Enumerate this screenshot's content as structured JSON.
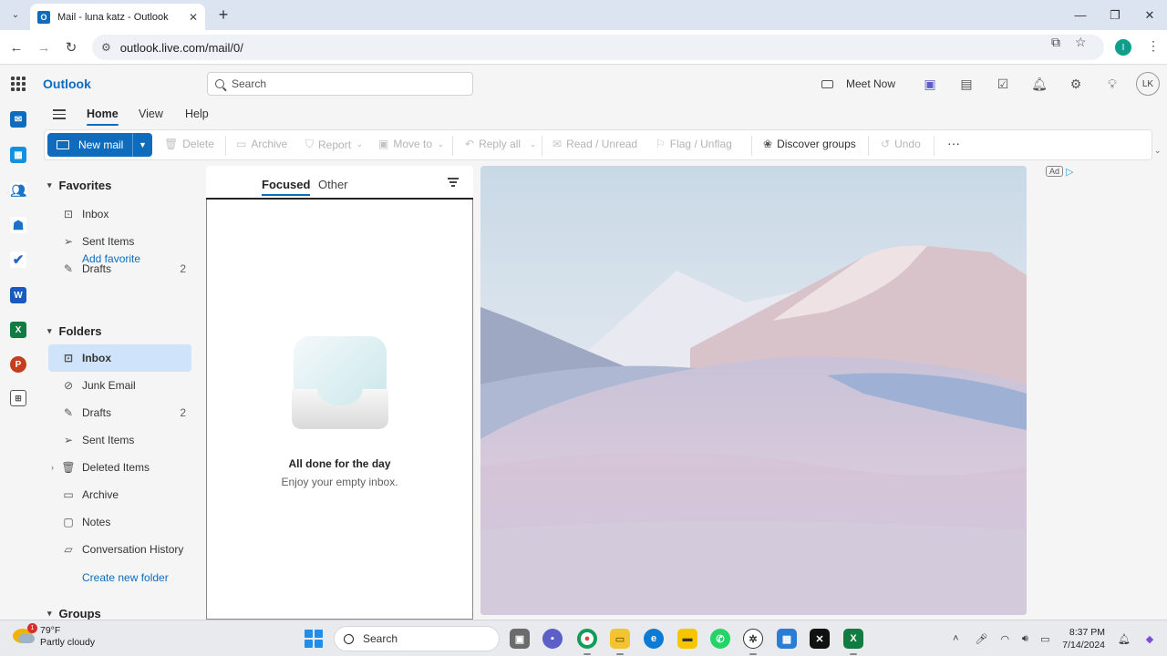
{
  "browser": {
    "tab_title": "Mail - luna katz - Outlook",
    "url": "outlook.live.com/mail/0/",
    "profile_initial": "I"
  },
  "app": {
    "brand": "Outlook",
    "search_placeholder": "Search",
    "meet_now": "Meet Now",
    "avatar_initials": "LK",
    "accent_color": "#0f6cbd"
  },
  "menu_tabs": [
    "Home",
    "View",
    "Help"
  ],
  "ribbon": {
    "new_mail": "New mail",
    "delete": "Delete",
    "archive": "Archive",
    "report": "Report",
    "move_to": "Move to",
    "reply_all": "Reply all",
    "read_unread": "Read / Unread",
    "flag_unflag": "Flag / Unflag",
    "discover_groups": "Discover groups",
    "undo": "Undo",
    "more": "···"
  },
  "favorites": {
    "header": "Favorites",
    "items": [
      {
        "label": "Inbox",
        "count": "",
        "icon": "inbox-icon"
      },
      {
        "label": "Sent Items",
        "count": "",
        "icon": "send-icon"
      },
      {
        "label": "Drafts",
        "count": "2",
        "icon": "draft-icon"
      }
    ],
    "add_favorite": "Add favorite"
  },
  "folders": {
    "header": "Folders",
    "items": [
      {
        "label": "Inbox",
        "count": "",
        "icon": "inbox-icon",
        "selected": true
      },
      {
        "label": "Junk Email",
        "count": "",
        "icon": "junk-icon"
      },
      {
        "label": "Drafts",
        "count": "2",
        "icon": "draft-icon"
      },
      {
        "label": "Sent Items",
        "count": "",
        "icon": "send-icon"
      },
      {
        "label": "Deleted Items",
        "count": "",
        "icon": "trash-icon"
      },
      {
        "label": "Archive",
        "count": "",
        "icon": "archive-icon"
      },
      {
        "label": "Notes",
        "count": "",
        "icon": "note-icon"
      },
      {
        "label": "Conversation History",
        "count": "",
        "icon": "folder-icon"
      }
    ],
    "create_new_folder": "Create new folder"
  },
  "groups": {
    "header": "Groups"
  },
  "message_list": {
    "tabs": [
      "Focused",
      "Other"
    ],
    "empty_title": "All done for the day",
    "empty_subtitle": "Enjoy your empty inbox."
  },
  "ad": {
    "badge": "Ad"
  },
  "taskbar": {
    "weather_temp": "79°F",
    "weather_desc": "Partly cloudy",
    "weather_badge": "1",
    "search_label": "Search",
    "time": "8:37 PM",
    "date": "7/14/2024"
  }
}
